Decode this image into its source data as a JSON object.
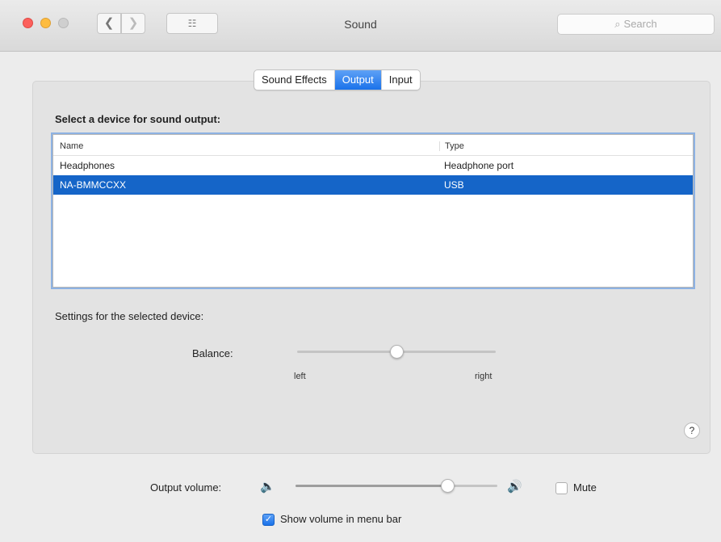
{
  "window": {
    "title": "Sound",
    "search_placeholder": "Search",
    "grid_label": "☷",
    "back_glyph": "❮",
    "forward_glyph": "❯",
    "search_glyph": "⌕"
  },
  "tabs": [
    {
      "label": "Sound Effects",
      "active": false
    },
    {
      "label": "Output",
      "active": true
    },
    {
      "label": "Input",
      "active": false
    }
  ],
  "device_list": {
    "heading": "Select a device for sound output:",
    "columns": [
      "Name",
      "Type"
    ],
    "rows": [
      {
        "name": "Headphones",
        "type": "Headphone port",
        "selected": false
      },
      {
        "name": "NA-BMMCCXX",
        "type": "USB",
        "selected": true
      }
    ]
  },
  "settings": {
    "heading": "Settings for the selected device:",
    "balance_label": "Balance:",
    "left_label": "left",
    "right_label": "right",
    "balance_value": 0.5
  },
  "help": {
    "glyph": "?"
  },
  "output": {
    "volume_label": "Output volume:",
    "volume_value": 0.75,
    "low_icon": "🔈",
    "high_icon": "🔊",
    "mute_label": "Mute",
    "mute_checked": false,
    "show_volume_label": "Show volume in menu bar",
    "show_volume_checked": true,
    "check_glyph": "✓"
  },
  "colors": {
    "accent": "#1a72ea",
    "selection": "#1565c8"
  }
}
